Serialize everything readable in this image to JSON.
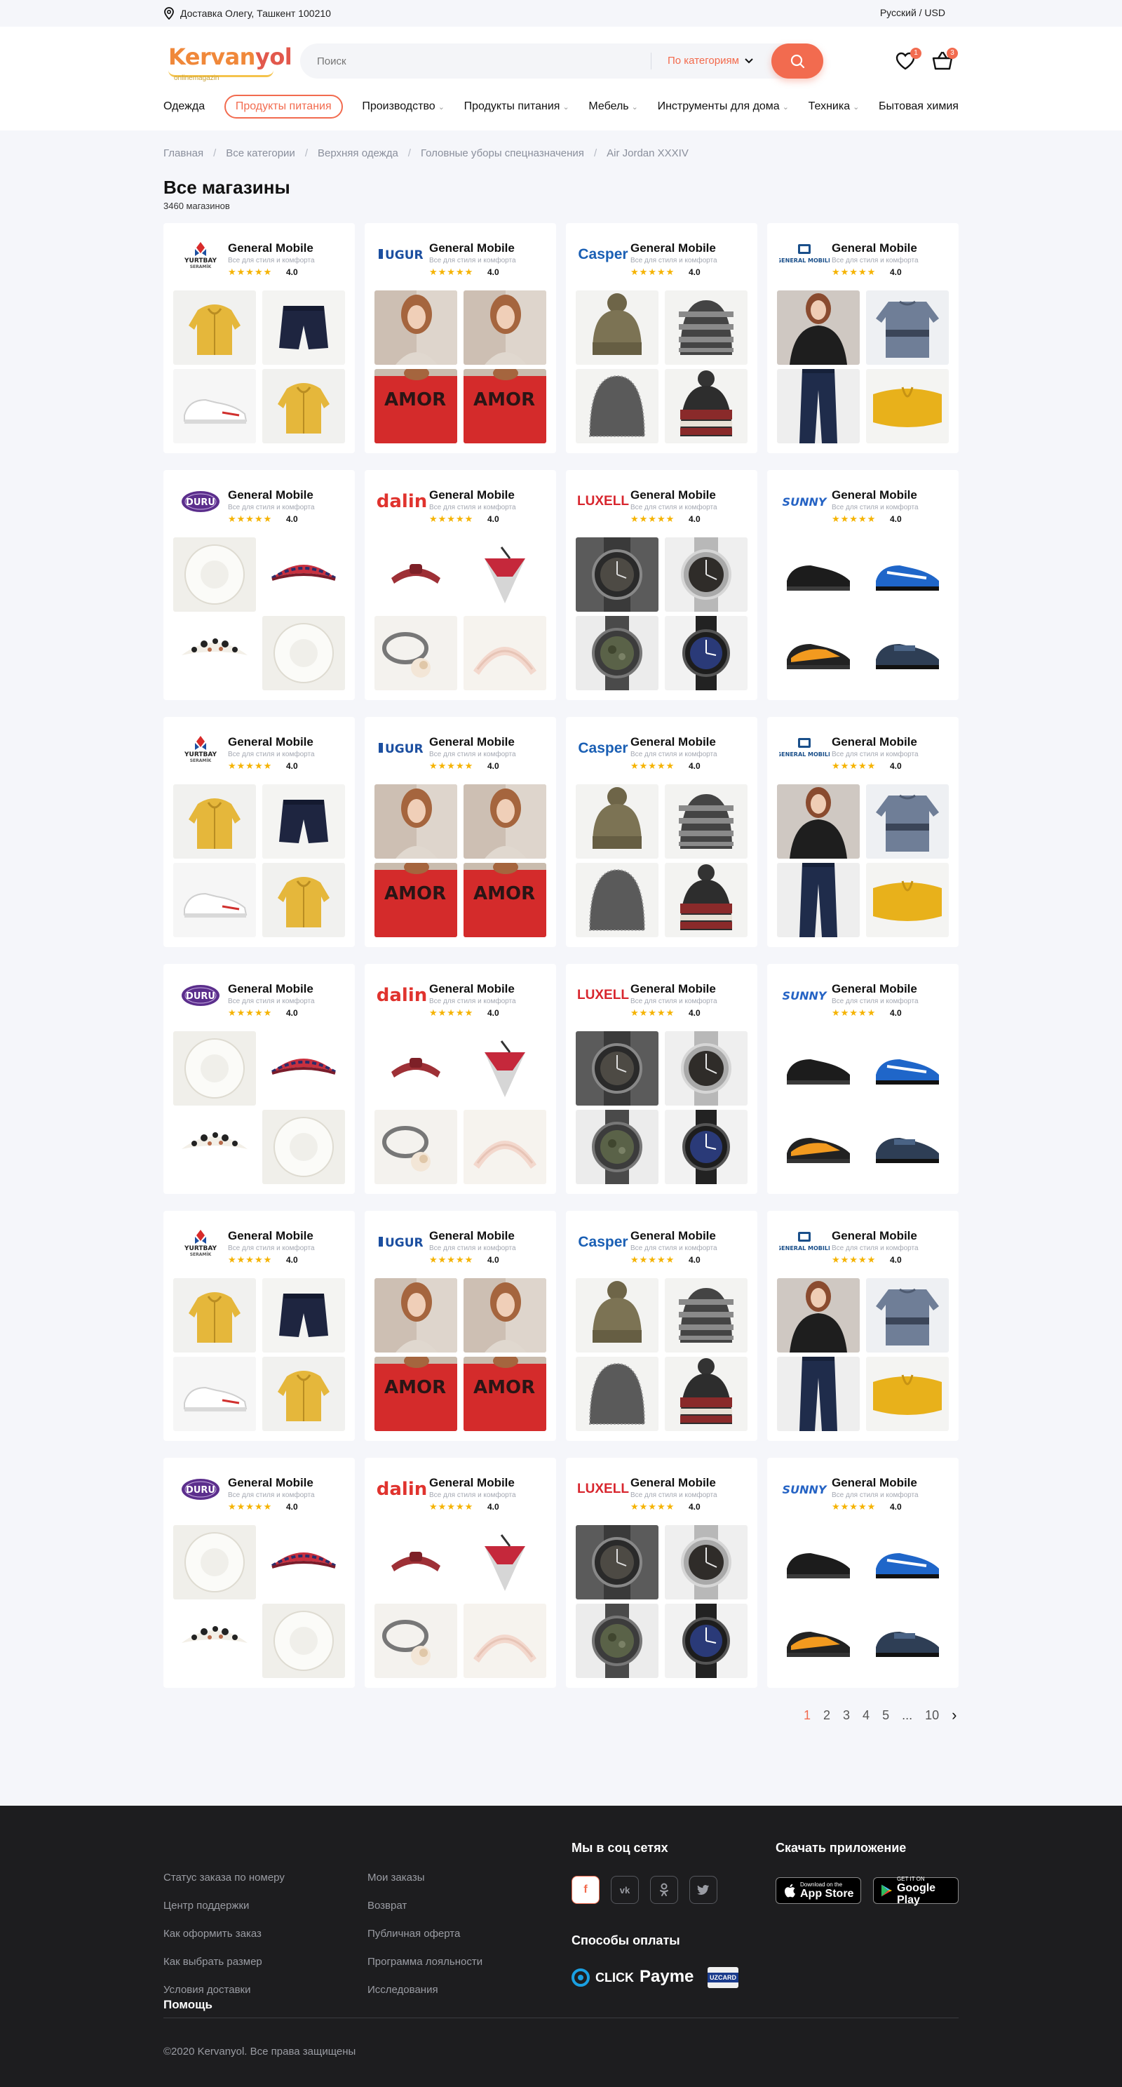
{
  "location": {
    "text": "Доставка Олегу, Ташкент 100210"
  },
  "language": {
    "text": "Русский / USD"
  },
  "logo": {
    "text": "Kervanyol",
    "sub": "onlinemagazin"
  },
  "search": {
    "placeholder": "Поиск",
    "category": "По категориям"
  },
  "header_badges": {
    "wishlist": "1",
    "cart": "3"
  },
  "nav": [
    {
      "label": "Одежда",
      "has_dropdown": false
    },
    {
      "label": "Продукты питания",
      "has_dropdown": false,
      "active": true
    },
    {
      "label": "Производство",
      "has_dropdown": true
    },
    {
      "label": "Продукты питания",
      "has_dropdown": true
    },
    {
      "label": "Мебель",
      "has_dropdown": true
    },
    {
      "label": "Инструменты для дома",
      "has_dropdown": true
    },
    {
      "label": "Техника",
      "has_dropdown": true
    },
    {
      "label": "Бытовая химия",
      "has_dropdown": false
    }
  ],
  "breadcrumb": [
    "Главная",
    "Все категории",
    "Верхняя одежда",
    "Головные уборы спецназначения",
    "Air Jordan XXXIV"
  ],
  "page": {
    "title": "Все магазины",
    "count": "3460 магазинов"
  },
  "store_template": {
    "name": "General Mobile",
    "desc": "Все для стиля и комфорта",
    "stars": "★★★★★",
    "rating": "4.0"
  },
  "stores": [
    {
      "brand": "YURTBAY",
      "brand_sub": "SERAMİK",
      "brand_color": "#222222",
      "thumbs": [
        "yellow-hoodie",
        "navy-shorts",
        "sneaker",
        "yellow-hoodie"
      ]
    },
    {
      "brand": "UGUR",
      "brand_sub": "",
      "brand_color": "#1c4fa0",
      "thumbs": [
        "model-top",
        "model-top",
        "red-sweater",
        "red-sweater"
      ]
    },
    {
      "brand": "Casper",
      "brand_sub": "",
      "brand_color": "#1a5fb4",
      "thumbs": [
        "olive-beanie",
        "striped-beanie",
        "grey-beanie",
        "pattern-beanie"
      ]
    },
    {
      "brand": "GENERAL MOBILE",
      "brand_sub": "",
      "brand_color": "#1a4f8a",
      "thumbs": [
        "woman-black",
        "sweater-grey",
        "jeans",
        "yellow-band"
      ]
    },
    {
      "brand": "DURU",
      "brand_sub": "",
      "brand_color": "#5b2e8c",
      "thumbs": [
        "white-scrunchie",
        "plaid-headband",
        "print-band",
        "white-scrunchie"
      ]
    },
    {
      "brand": "dalin",
      "brand_sub": "",
      "brand_color": "#e0332e",
      "thumbs": [
        "red-headband",
        "red-bandana",
        "grey-hairtie",
        "cream-headband"
      ]
    },
    {
      "brand": "LUXELL",
      "brand_sub": "",
      "brand_color": "#d8262e",
      "thumbs": [
        "watch-dark",
        "watch-steel",
        "watch-camo",
        "watch-blue"
      ]
    },
    {
      "brand": "SUNNY",
      "brand_sub": "",
      "brand_color": "#2563c4",
      "thumbs": [
        "shoe-black",
        "shoe-blue",
        "shoe-orange",
        "shoe-navy"
      ]
    }
  ],
  "pagination": {
    "pages": [
      "1",
      "2",
      "3",
      "4",
      "5",
      "...",
      "10"
    ],
    "current": "1",
    "next": "›"
  },
  "footer": {
    "help_heading": "Помощь",
    "col1": [
      "Статус заказа по номеру",
      "Центр поддержки",
      "Как оформить заказ",
      "Как выбрать размер",
      "Условия доставки"
    ],
    "col2": [
      "Мои заказы",
      "Возврат",
      "Публичная оферта",
      "Программа лояльности",
      "Исследования"
    ],
    "social_heading": "Мы в соц сетях",
    "social": [
      "facebook-icon",
      "vk-icon",
      "odnoklassniki-icon",
      "twitter-icon"
    ],
    "payment_heading": "Способы оплаты",
    "payments": [
      "CLICK",
      "Payme",
      "UZCARD"
    ],
    "app_heading": "Скачать приложение",
    "appstore_small": "Download on the",
    "appstore_big": "App Store",
    "googleplay_small": "GET IT ON",
    "googleplay_big": "Google Play",
    "copyright": "©2020 Kervanyol. Все права защищены"
  },
  "colors": {
    "accent": "#f26b4f",
    "footer_bg": "#1d1d1f",
    "page_bg": "#f5f6fa",
    "star": "#f5b301"
  }
}
